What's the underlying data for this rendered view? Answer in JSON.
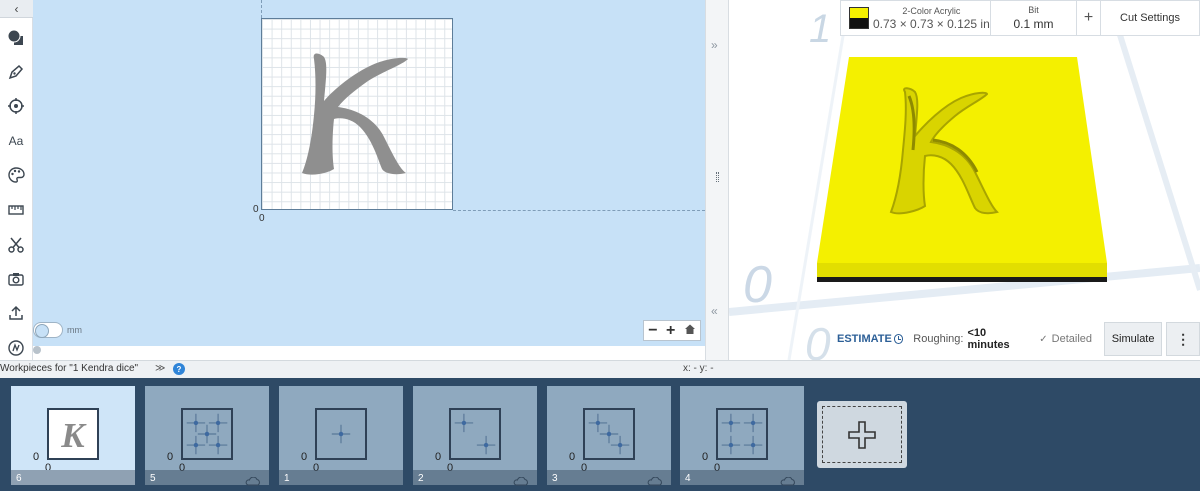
{
  "toolbar": {
    "items": [
      {
        "name": "shapes-icon"
      },
      {
        "name": "pen-icon"
      },
      {
        "name": "target-icon"
      },
      {
        "name": "text-tool",
        "label": "Aa"
      },
      {
        "name": "palette-icon"
      },
      {
        "name": "ruler-icon"
      },
      {
        "name": "scissors-icon"
      },
      {
        "name": "camera-icon"
      },
      {
        "name": "upload-icon"
      },
      {
        "name": "apps-icon"
      }
    ]
  },
  "canvas": {
    "origin_x": "0",
    "origin_y": "0",
    "unit": "mm",
    "zoom_out": "−",
    "zoom_in": "+",
    "glyph": "K"
  },
  "preview": {
    "material": {
      "name": "2-Color Acrylic",
      "dims": "0.73 × 0.73 × 0.125 in",
      "color_top": "#f5f000",
      "color_bottom": "#111111"
    },
    "bit": {
      "label": "Bit",
      "value": "0.1 mm"
    },
    "add": "+",
    "cut_settings": "Cut Settings",
    "axis_top": "1",
    "axis_left": "0",
    "axis_bottom": "0",
    "estimate": {
      "label": "ESTIMATE",
      "roughing_label": "Roughing:",
      "roughing_value": "<10 minutes",
      "detailed": "Detailed"
    },
    "simulate": "Simulate",
    "more": "⋮"
  },
  "workpieces": {
    "title": "Workpieces for \"1 Kendra dice\"",
    "help": "?",
    "xy": "x: - y: -",
    "cards": [
      {
        "num": "6",
        "active": true,
        "type": "glyph",
        "glyph": "K",
        "cloud": false
      },
      {
        "num": "5",
        "active": false,
        "type": "dots5",
        "cloud": true
      },
      {
        "num": "1",
        "active": false,
        "type": "dots1",
        "cloud": false
      },
      {
        "num": "2",
        "active": false,
        "type": "dots2",
        "cloud": true
      },
      {
        "num": "3",
        "active": false,
        "type": "dots3",
        "cloud": true
      },
      {
        "num": "4",
        "active": false,
        "type": "dots4",
        "cloud": true
      }
    ],
    "zero": "0"
  }
}
